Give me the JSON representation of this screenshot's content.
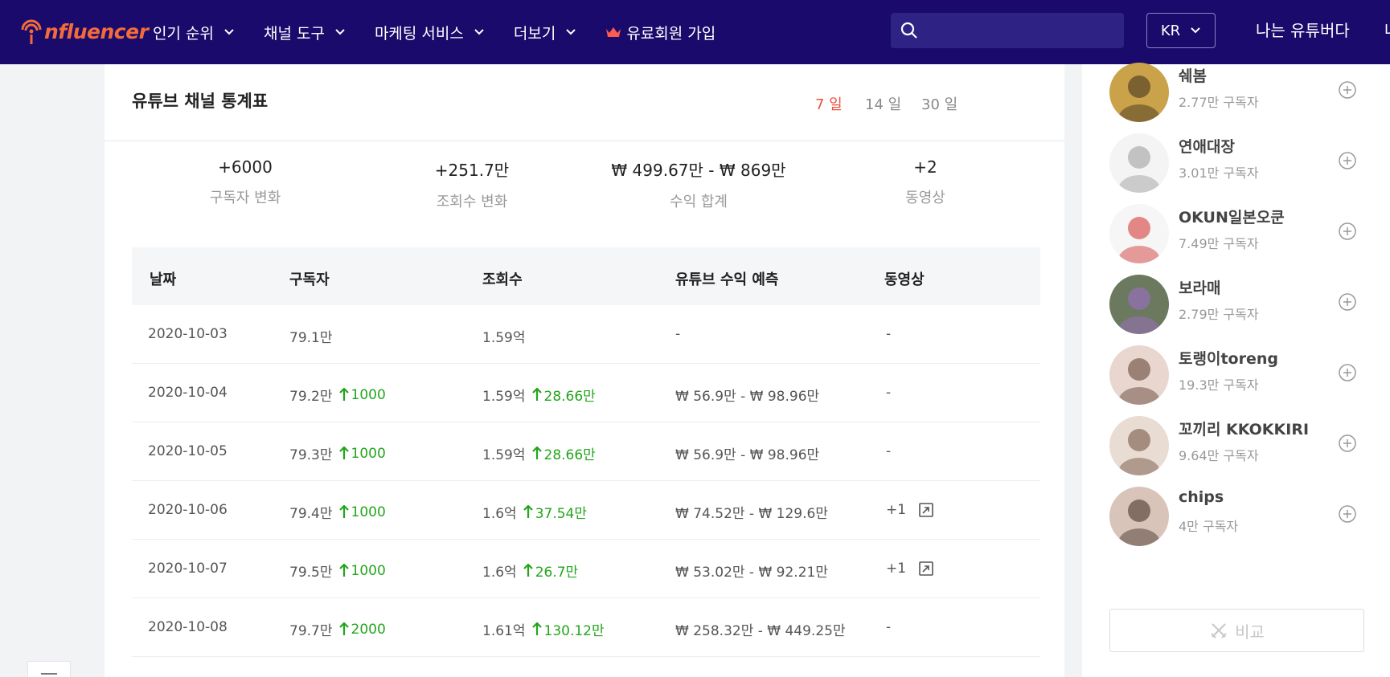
{
  "header": {
    "logo_text": "nfluencer",
    "nav": [
      {
        "label": "인기 순위"
      },
      {
        "label": "채널 도구"
      },
      {
        "label": "마케팅 서비스"
      },
      {
        "label": "더보기"
      }
    ],
    "premium_label": "유료회원 가입",
    "search_placeholder": "",
    "lang": "KR",
    "youtuber_label": "나는 유튜버다",
    "edge_text": "나",
    "colors": {
      "bg": "#1a0a6b",
      "logo": "#f36b3b",
      "crown": "#ff5a4e"
    }
  },
  "card": {
    "title": "유튜브 채널 통계표",
    "periods": [
      "7 일",
      "14 일",
      "30 일"
    ],
    "active_period": "7 일",
    "summary": [
      {
        "value": "+6000",
        "label": "구독자 변화"
      },
      {
        "value": "+251.7만",
        "label": "조회수 변화"
      },
      {
        "value": "₩ 499.67만 - ₩ 869만",
        "label": "수익 합계"
      },
      {
        "value": "+2",
        "label": "동영상"
      }
    ],
    "columns": [
      "날짜",
      "구독자",
      "조회수",
      "유튜브 수익 예측",
      "동영상"
    ],
    "rows": [
      {
        "date": "2020-10-03",
        "subs": "79.1만",
        "subs_inc": "",
        "views": "1.59억",
        "views_inc": "",
        "revenue": "-",
        "videos": "-"
      },
      {
        "date": "2020-10-04",
        "subs": "79.2만",
        "subs_inc": "1000",
        "views": "1.59억",
        "views_inc": "28.66만",
        "revenue": "₩ 56.9만 - ₩ 98.96만",
        "videos": "-"
      },
      {
        "date": "2020-10-05",
        "subs": "79.3만",
        "subs_inc": "1000",
        "views": "1.59억",
        "views_inc": "28.66만",
        "revenue": "₩ 56.9만 - ₩ 98.96만",
        "videos": "-"
      },
      {
        "date": "2020-10-06",
        "subs": "79.4만",
        "subs_inc": "1000",
        "views": "1.6억",
        "views_inc": "37.54만",
        "revenue": "₩ 74.52만 - ₩ 129.6만",
        "videos": "+1"
      },
      {
        "date": "2020-10-07",
        "subs": "79.5만",
        "subs_inc": "1000",
        "views": "1.6억",
        "views_inc": "26.7만",
        "revenue": "₩ 53.02만 - ₩ 92.21만",
        "videos": "+1"
      },
      {
        "date": "2020-10-08",
        "subs": "79.7만",
        "subs_inc": "2000",
        "views": "1.61억",
        "views_inc": "130.12만",
        "revenue": "₩ 258.32만 - ₩ 449.25만",
        "videos": "-"
      }
    ],
    "colors": {
      "increase": "#23a51c",
      "active_period": "#f04d3a"
    }
  },
  "sidebar": {
    "channels": [
      {
        "name": "쉐봄",
        "subs": "2.77만 구독자"
      },
      {
        "name": "연애대장",
        "subs": "3.01만 구독자"
      },
      {
        "name": "OKUN일본오쿤",
        "subs": "7.49만 구독자"
      },
      {
        "name": "보라매",
        "subs": "2.79만 구독자"
      },
      {
        "name": "토랭이toreng",
        "subs": "19.3만 구독자"
      },
      {
        "name": "꼬끼리 KKOKKIRI",
        "subs": "9.64만 구독자"
      },
      {
        "name": "chips",
        "subs": "4만 구독자"
      }
    ],
    "compare_label": "비교"
  }
}
